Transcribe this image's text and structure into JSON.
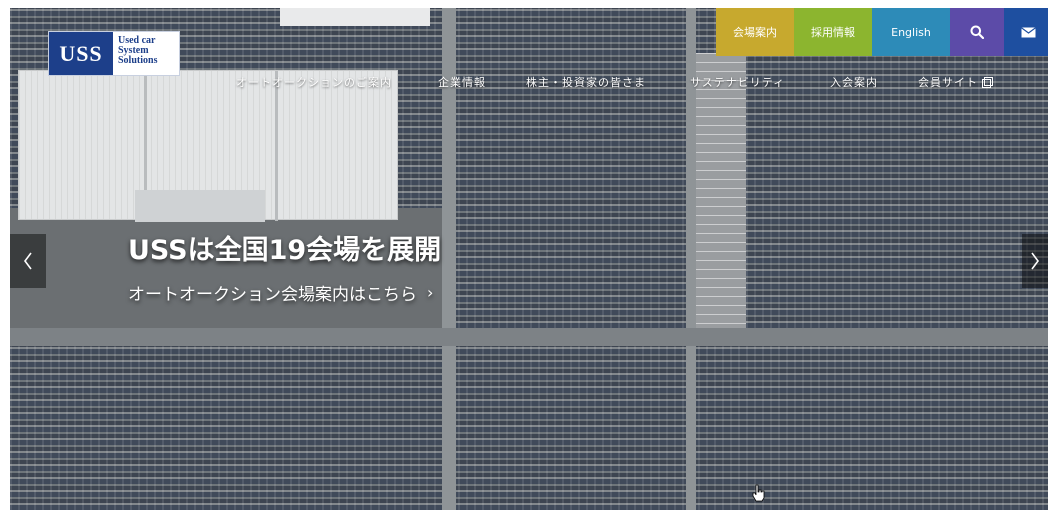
{
  "logo": {
    "mark": "USS",
    "line1": "Used car",
    "line2": "System",
    "line3": "Solutions"
  },
  "topbar": {
    "venue_label": "会場案内",
    "recruit_label": "採用情報",
    "english_label": "English",
    "search_icon": "search-icon",
    "mail_icon": "mail-icon",
    "colors": {
      "venue": "#c7a92e",
      "recruit": "#8cb52f",
      "english": "#2d8bb8",
      "search": "#5c4ba8",
      "mail": "#1e4fa0"
    }
  },
  "nav": {
    "items": [
      {
        "label": "オートオークションのご案内"
      },
      {
        "label": "企業情報"
      },
      {
        "label": "株主・投資家の皆さま"
      },
      {
        "label": "サステナビリティ"
      },
      {
        "label": "入会案内"
      },
      {
        "label": "会員サイト"
      }
    ]
  },
  "hero": {
    "headline": "USSは全国19会場を展開",
    "subline": "オートオークション会場案内はこちら",
    "subline_chevron": "›",
    "prev_icon": "chevron-left-icon",
    "next_icon": "chevron-right-icon"
  }
}
